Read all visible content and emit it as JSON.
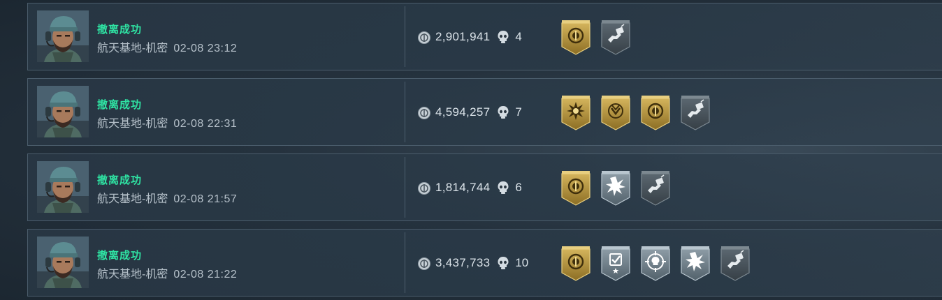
{
  "records": [
    {
      "status": "撤离成功",
      "map": "航天基地-机密",
      "time": "02-08 23:12",
      "money": "2,901,941",
      "kills": "4",
      "badges": [
        {
          "style": "gold",
          "icon": "gear-coin-icon"
        },
        {
          "style": "dark",
          "icon": "hand-card-icon"
        }
      ]
    },
    {
      "status": "撤离成功",
      "map": "航天基地-机密",
      "time": "02-08 22:31",
      "money": "4,594,257",
      "kills": "7",
      "badges": [
        {
          "style": "gold",
          "icon": "sunburst-icon"
        },
        {
          "style": "gold",
          "icon": "arrow-emblem-icon"
        },
        {
          "style": "gold",
          "icon": "gear-coin-icon"
        },
        {
          "style": "dark",
          "icon": "hand-card-icon"
        }
      ]
    },
    {
      "status": "撤离成功",
      "map": "航天基地-机密",
      "time": "02-08 21:57",
      "money": "1,814,744",
      "kills": "6",
      "badges": [
        {
          "style": "gold",
          "icon": "gear-coin-icon"
        },
        {
          "style": "silver",
          "icon": "burst-icon"
        },
        {
          "style": "dark",
          "icon": "hand-card-icon"
        }
      ]
    },
    {
      "status": "撤离成功",
      "map": "航天基地-机密",
      "time": "02-08 21:22",
      "money": "3,437,733",
      "kills": "10",
      "badges": [
        {
          "style": "gold",
          "icon": "gear-coin-icon"
        },
        {
          "style": "silver",
          "icon": "checklist-star-icon"
        },
        {
          "style": "silver",
          "icon": "crosshair-skull-icon"
        },
        {
          "style": "silver",
          "icon": "burst-icon"
        },
        {
          "style": "dark",
          "icon": "hand-card-icon"
        }
      ]
    }
  ]
}
